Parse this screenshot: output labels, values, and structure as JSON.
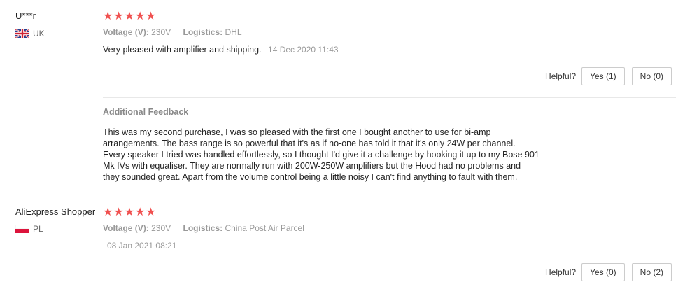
{
  "reviews": [
    {
      "user": "U***r",
      "country": "UK",
      "flag_icon": "uk-flag-icon",
      "stars": [
        "★",
        "★",
        "★",
        "★",
        "★"
      ],
      "voltage_label": "Voltage (V):",
      "voltage_value": "230V",
      "logistics_label": "Logistics:",
      "logistics_value": "DHL",
      "text": "Very pleased with amplifier and shipping.",
      "date": "14 Dec 2020 11:43",
      "helpful_label": "Helpful?",
      "yes_label": "Yes (1)",
      "no_label": "No (0)",
      "additional_title": "Additional Feedback",
      "additional_lines": [
        "This was my second purchase, I was so pleased with the first one I bought another to use for bi-amp",
        "arrangements. The bass range is so powerful that it's as if no-one has told it that it's only 24W per channel.",
        "Every speaker I tried was handled effortlessly, so I thought I'd give it a challenge by hooking it up to my Bose 901",
        "Mk IVs with equaliser. They are normally run with 200W-250W amplifiers but the Hood had no problems and",
        "they sounded great. Apart from the volume control being a little noisy I can't find anything to fault with them."
      ]
    },
    {
      "user": "AliExpress Shopper",
      "country": "PL",
      "flag_icon": "poland-flag-icon",
      "stars": [
        "★",
        "★",
        "★",
        "★",
        "★"
      ],
      "voltage_label": "Voltage (V):",
      "voltage_value": "230V",
      "logistics_label": "Logistics:",
      "logistics_value": "China Post Air Parcel",
      "text": "",
      "date": "08 Jan 2021 08:21",
      "helpful_label": "Helpful?",
      "yes_label": "Yes (0)",
      "no_label": "No (2)"
    }
  ],
  "colors": {
    "star": "#f0504f",
    "muted_text": "#999999",
    "divider": "#e8e8e8"
  }
}
